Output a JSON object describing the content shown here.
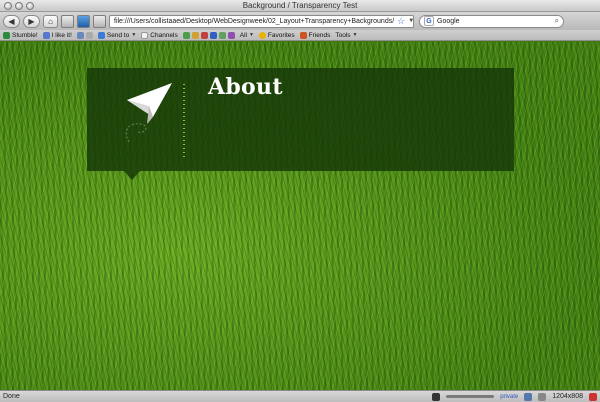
{
  "window": {
    "title": "Background / Transparency Test"
  },
  "toolbar": {
    "back_label": "◀",
    "forward_label": "▶",
    "home_label": "⌂",
    "url": "file:///Users/collistaaed/Desktop/WebDesignweek/02_Layout+Transparency+Backgrounds/",
    "search_placeholder": "Google",
    "search_engine_letter": "G"
  },
  "bookmarks": [
    {
      "label": "Stumble!",
      "icon": "stumble-icon",
      "color": "#2e8b3a"
    },
    {
      "label": "I like it!",
      "icon": "thumbs-up-icon",
      "color": "#5577cc"
    },
    {
      "label": "Send to",
      "icon": "send-icon",
      "color": "#3a7bd5",
      "dropdown": true
    },
    {
      "label": "Channels",
      "icon": "channels-icon",
      "color": "#e0e0e0"
    },
    {
      "label": "All",
      "icon": "all-icon",
      "color": "#777777",
      "dropdown": true
    },
    {
      "label": "Favorites",
      "icon": "favorites-icon",
      "color": "#e8b400"
    },
    {
      "label": "Friends",
      "icon": "friends-icon",
      "color": "#cc5522"
    },
    {
      "label": "Tools",
      "icon": "tools-icon",
      "color": "#888888",
      "dropdown": true
    }
  ],
  "page": {
    "heading": "About",
    "banner_color": "#163708"
  },
  "status": {
    "text": "Done",
    "private_label": "private",
    "dimensions": "1204x808"
  }
}
